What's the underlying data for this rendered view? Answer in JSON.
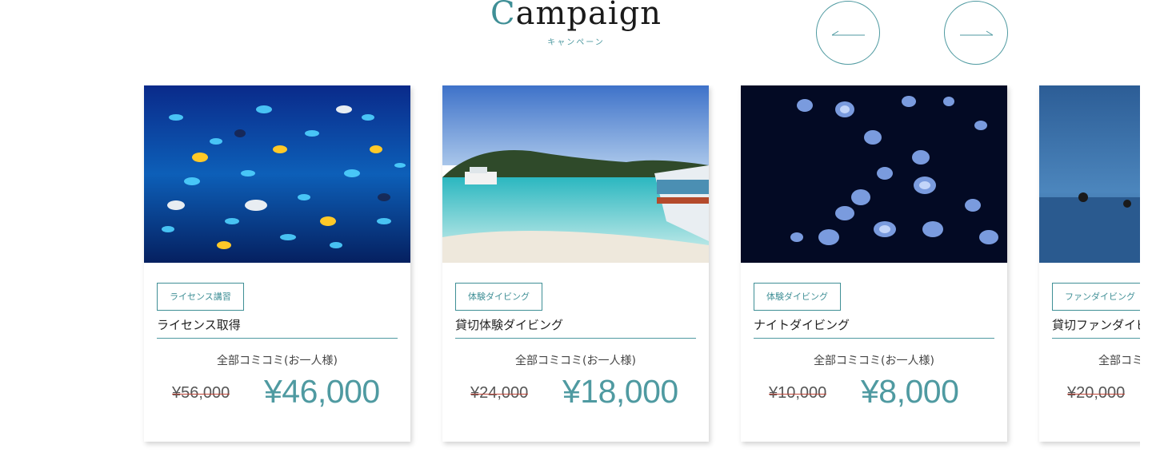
{
  "header": {
    "title_first": "C",
    "title_rest": "ampaign",
    "subtitle": "キャンペーン"
  },
  "nav": {
    "prev_icon": "arrow-left-icon",
    "next_icon": "arrow-right-icon"
  },
  "colors": {
    "accent": "#4f9aa1",
    "strike": "#c0473a"
  },
  "cards": [
    {
      "tag": "ライセンス講習",
      "title": "ライセンス取得",
      "note": "全部コミコミ(お一人様)",
      "old_price": "¥56,000",
      "new_price": "¥46,000"
    },
    {
      "tag": "体験ダイビング",
      "title": "貸切体験ダイビング",
      "note": "全部コミコミ(お一人様)",
      "old_price": "¥24,000",
      "new_price": "¥18,000"
    },
    {
      "tag": "体験ダイビング",
      "title": "ナイトダイビング",
      "note": "全部コミコミ(お一人様)",
      "old_price": "¥10,000",
      "new_price": "¥8,000"
    },
    {
      "tag": "ファンダイビング",
      "title": "貸切ファンダイビ",
      "note": "全部コミ",
      "old_price": "¥20,000",
      "new_price": ""
    }
  ]
}
